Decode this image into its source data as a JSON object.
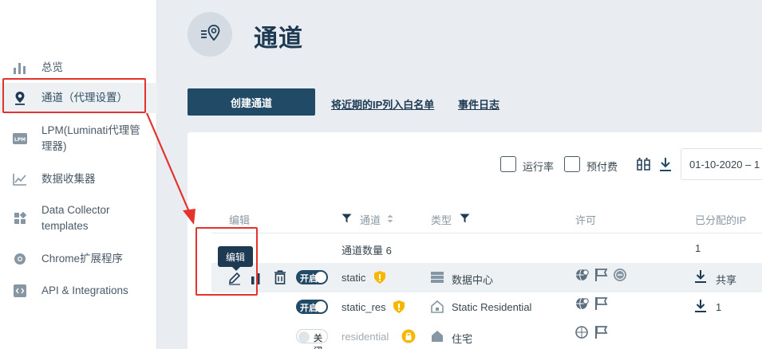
{
  "sidebar": {
    "items": [
      {
        "label": "总览",
        "icon": "bar-chart-icon"
      },
      {
        "label": "通道（代理设置）",
        "icon": "location-pin-icon"
      },
      {
        "label": "LPM(Luminati代理管理器)",
        "icon": "lpm-icon"
      },
      {
        "label": "数据收集器",
        "icon": "line-chart-icon"
      },
      {
        "label": "Data Collector templates",
        "icon": "grid-icon"
      },
      {
        "label": "Chrome扩展程序",
        "icon": "chrome-icon"
      },
      {
        "label": "API & Integrations",
        "icon": "code-icon"
      }
    ],
    "lpm_badge": "LPM"
  },
  "page": {
    "title": "通道",
    "create_button": "创建通道",
    "whitelist_link": "将近期的IP列入白名单",
    "event_log_link": "事件日志"
  },
  "toolbar": {
    "uptime_label": "运行率",
    "prepaid_label": "预付费",
    "date_range": "01-10-2020 – 1"
  },
  "table": {
    "headers": {
      "edit": "编辑",
      "channel": "通道",
      "type": "类型",
      "permission": "许可",
      "assigned_ip": "已分配的IP"
    },
    "summary": {
      "label": "通道数量 6",
      "assigned": "1"
    },
    "rows": [
      {
        "toggle": "开启",
        "on": true,
        "name": "static",
        "type": "数据中心",
        "assigned": "共享"
      },
      {
        "toggle": "开启",
        "on": true,
        "name": "static_res",
        "type": "Static Residential",
        "assigned": "1"
      },
      {
        "toggle": "关闭",
        "on": false,
        "name": "residential",
        "type": "住宅",
        "assigned": ""
      }
    ],
    "edit_tooltip": "编辑"
  },
  "colors": {
    "primary": "#204a66",
    "highlight_red": "#e4332c",
    "warning": "#f5b700"
  }
}
